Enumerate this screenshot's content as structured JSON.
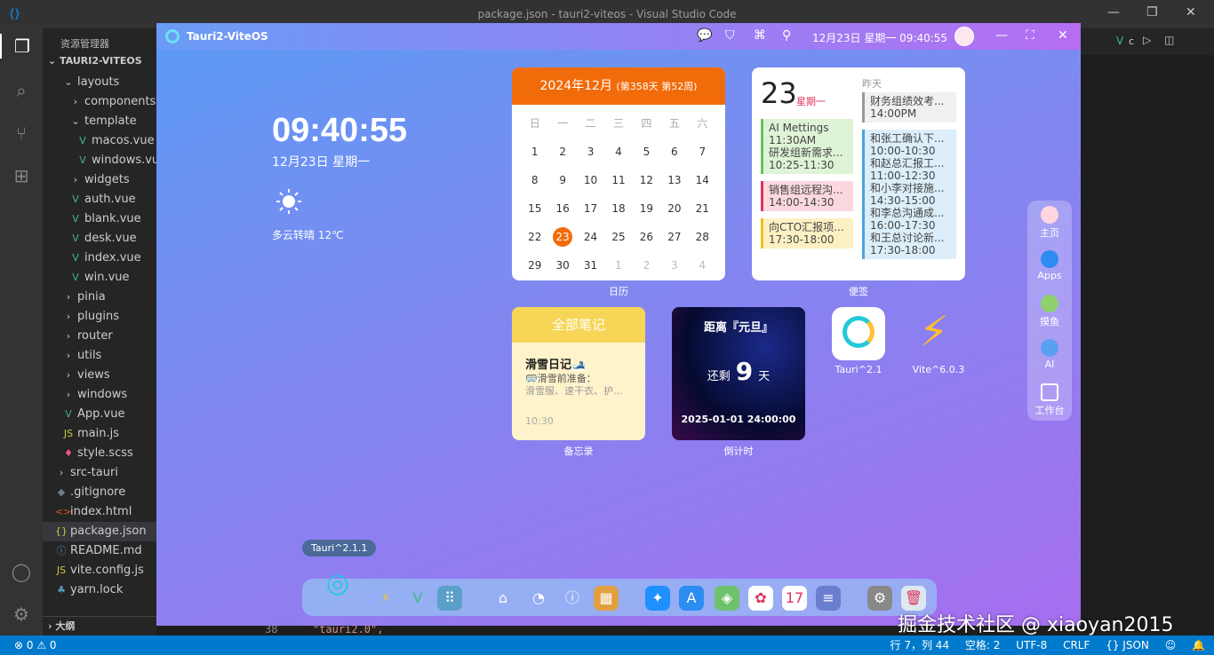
{
  "window": {
    "title": "package.json - tauri2-viteos - Visual Studio Code"
  },
  "sidebar": {
    "header": "资源管理器",
    "root": "TAURI2-VITEOS",
    "outline": "大纲",
    "items": [
      {
        "label": "layouts",
        "icon": "chevron-down",
        "indent": 1
      },
      {
        "label": "components",
        "icon": "chevron-right",
        "indent": 2
      },
      {
        "label": "template",
        "icon": "chevron-down",
        "indent": 2
      },
      {
        "label": "macos.vue",
        "icon": "vue",
        "indent": 3
      },
      {
        "label": "windows.vue",
        "icon": "vue",
        "indent": 3
      },
      {
        "label": "widgets",
        "icon": "chevron-right",
        "indent": 2
      },
      {
        "label": "auth.vue",
        "icon": "vue",
        "indent": 2
      },
      {
        "label": "blank.vue",
        "icon": "vue",
        "indent": 2
      },
      {
        "label": "desk.vue",
        "icon": "vue",
        "indent": 2
      },
      {
        "label": "index.vue",
        "icon": "vue",
        "indent": 2
      },
      {
        "label": "win.vue",
        "icon": "vue",
        "indent": 2
      },
      {
        "label": "pinia",
        "icon": "chevron-right",
        "indent": 1
      },
      {
        "label": "plugins",
        "icon": "chevron-right",
        "indent": 1
      },
      {
        "label": "router",
        "icon": "chevron-right",
        "indent": 1
      },
      {
        "label": "utils",
        "icon": "chevron-right",
        "indent": 1
      },
      {
        "label": "views",
        "icon": "chevron-right",
        "indent": 1
      },
      {
        "label": "windows",
        "icon": "chevron-right",
        "indent": 1
      },
      {
        "label": "App.vue",
        "icon": "vue",
        "indent": 1
      },
      {
        "label": "main.js",
        "icon": "js",
        "indent": 1
      },
      {
        "label": "style.scss",
        "icon": "scss",
        "indent": 1
      },
      {
        "label": "src-tauri",
        "icon": "chevron-right",
        "indent": 0
      },
      {
        "label": ".gitignore",
        "icon": "git",
        "indent": 0
      },
      {
        "label": "index.html",
        "icon": "html",
        "indent": 0
      },
      {
        "label": "package.json",
        "icon": "json",
        "indent": 0,
        "selected": true
      },
      {
        "label": "README.md",
        "icon": "info",
        "indent": 0
      },
      {
        "label": "vite.config.js",
        "icon": "js",
        "indent": 0
      },
      {
        "label": "yarn.lock",
        "icon": "yarn",
        "indent": 0
      }
    ]
  },
  "editor": {
    "line_number": "38",
    "code": "\"tauri2.0\",",
    "tab_partial": "c"
  },
  "statusbar": {
    "errors": "⊗ 0 ⚠ 0",
    "position": "行 7，列 44",
    "spaces": "空格: 2",
    "encoding": "UTF-8",
    "eol": "CRLF",
    "lang": "{} JSON"
  },
  "watermark": "掘金技术社区 @ xiaoyan2015",
  "app": {
    "name": "Tauri2-ViteOS",
    "top_clock": "12月23日 星期一 09:40:55",
    "clock": "09:40:55",
    "date": "12月23日 星期一",
    "weather": "多云转晴 12℃",
    "calendar": {
      "title": "2024年12月",
      "sub": "(第358天 第52周)",
      "caption": "日历",
      "weekdays": [
        "日",
        "一",
        "二",
        "三",
        "四",
        "五",
        "六"
      ],
      "days": [
        "1",
        "2",
        "3",
        "4",
        "5",
        "6",
        "7",
        "8",
        "9",
        "10",
        "11",
        "12",
        "13",
        "14",
        "15",
        "16",
        "17",
        "18",
        "19",
        "20",
        "21",
        "22",
        "23",
        "24",
        "25",
        "26",
        "27",
        "28",
        "29",
        "30",
        "31",
        "1",
        "2",
        "3",
        "4"
      ],
      "today": "23"
    },
    "memo": {
      "day": "23",
      "weekday": "星期一",
      "yesterday": "昨天",
      "caption": "便签",
      "left": [
        {
          "lines": [
            "AI Mettings",
            "11:30AM",
            "研发组新需求...",
            "10:25-11:30"
          ],
          "bg": "#dff3d6",
          "bar": "#6ac35a"
        },
        {
          "lines": [
            "销售组远程沟...",
            "14:00-14:30"
          ],
          "bg": "#fbd8e0",
          "bar": "#e0325a"
        },
        {
          "lines": [
            "向CTO汇报项...",
            "17:30-18:00"
          ],
          "bg": "#fdf1c4",
          "bar": "#f0c020"
        }
      ],
      "right": [
        {
          "lines": [
            "财务组绩效考...",
            "14:00PM"
          ],
          "bg": "#f0f0f0",
          "bar": "#999"
        },
        {
          "lines": [
            "和张工确认下...",
            "10:00-10:30",
            "和赵总汇报工...",
            "11:00-12:30",
            "和小李对接施...",
            "14:30-15:00",
            "和李总沟通成...",
            "16:00-17:30",
            "和王总讨论新...",
            "17:30-18:00"
          ],
          "bg": "#dceefa",
          "bar": "#4aa3e0"
        }
      ]
    },
    "notes": {
      "header": "全部笔记",
      "title": "滑雪日记🎿",
      "line1": "🥽滑雪前准备：",
      "line2": "滑雪服、速干衣、护...",
      "time": "10:30",
      "caption": "备忘录"
    },
    "countdown": {
      "title": "距离『元旦』",
      "prefix": "还剩",
      "days": "9",
      "suffix": "天",
      "date": "2025-01-01 24:00:00",
      "caption": "倒计时"
    },
    "icons": [
      {
        "label": "Tauri^2.1"
      },
      {
        "label": "Vite^6.0.3"
      }
    ],
    "rightdock": [
      {
        "label": "主页"
      },
      {
        "label": "Apps"
      },
      {
        "label": "摸鱼"
      },
      {
        "label": "AI"
      },
      {
        "label": "工作台"
      }
    ],
    "tooltip": "Tauri^2.1.1",
    "dock": [
      {
        "icon": "tauri-icon",
        "bg": "transparent"
      },
      {
        "icon": "vite-icon",
        "bg": "transparent"
      },
      {
        "icon": "vue-icon",
        "bg": "transparent"
      },
      {
        "icon": "grid-icon",
        "bg": "#5aa0c8"
      },
      {
        "icon": "home-icon",
        "bg": "transparent"
      },
      {
        "icon": "dashboard-icon",
        "bg": "transparent"
      },
      {
        "icon": "info-icon",
        "bg": "transparent"
      },
      {
        "icon": "apps-icon",
        "bg": "#e0a040"
      },
      {
        "icon": "safari-icon",
        "bg": "#1e90ff"
      },
      {
        "icon": "appstore-icon",
        "bg": "#2d8cf0"
      },
      {
        "icon": "maps-icon",
        "bg": "#6cc36c"
      },
      {
        "icon": "photos-icon",
        "bg": "#fff"
      },
      {
        "icon": "calendar-icon",
        "bg": "#fff",
        "text": "17"
      },
      {
        "icon": "notes-icon",
        "bg": "#6a7ed0"
      },
      {
        "icon": "settings-icon",
        "bg": "#888"
      },
      {
        "icon": "trash-icon",
        "bg": "#dde8f0"
      }
    ]
  }
}
